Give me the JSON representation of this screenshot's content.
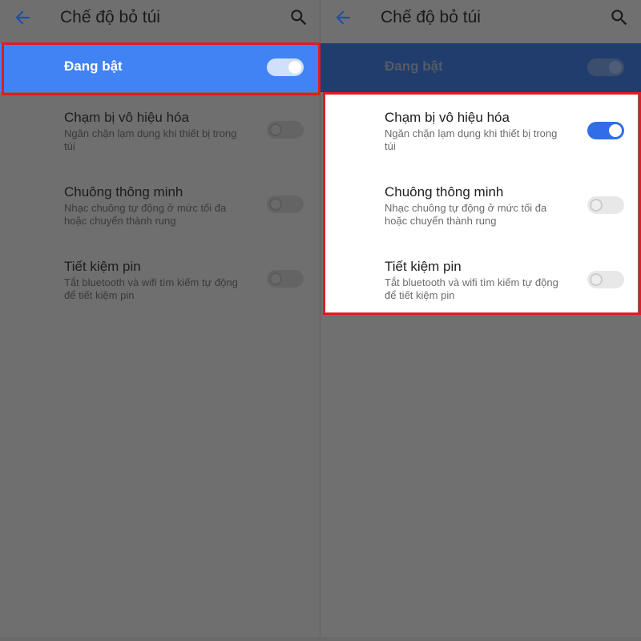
{
  "screens": [
    {
      "title": "Chế độ bỏ túi",
      "master": {
        "label": "Đang bật",
        "on": true
      },
      "items": [
        {
          "title": "Chạm bị vô hiệu hóa",
          "desc": "Ngăn chặn lạm dụng khi thiết bị trong túi",
          "on": false
        },
        {
          "title": "Chuông thông minh",
          "desc": "Nhạc chuông tự động ở mức tối đa hoặc chuyển thành rung",
          "on": false
        },
        {
          "title": "Tiết kiệm pin",
          "desc": "Tắt bluetooth và wifi tìm kiếm tự động để tiết kiệm pin",
          "on": false
        }
      ]
    },
    {
      "title": "Chế độ bỏ túi",
      "master": {
        "label": "Đang bật",
        "on": true
      },
      "items": [
        {
          "title": "Chạm bị vô hiệu hóa",
          "desc": "Ngăn chặn lạm dụng khi thiết bị trong túi",
          "on": true
        },
        {
          "title": "Chuông thông minh",
          "desc": "Nhạc chuông tự động ở mức tối đa hoặc chuyển thành rung",
          "on": false
        },
        {
          "title": "Tiết kiệm pin",
          "desc": "Tắt bluetooth và wifi tìm kiếm tự động để tiết kiệm pin",
          "on": false
        }
      ]
    }
  ],
  "icons": {
    "back": "back-arrow-icon",
    "search": "search-icon"
  },
  "colors": {
    "accent": "#4183f4",
    "toggle_on": "#2f6ee6",
    "highlight": "#e01b24"
  }
}
